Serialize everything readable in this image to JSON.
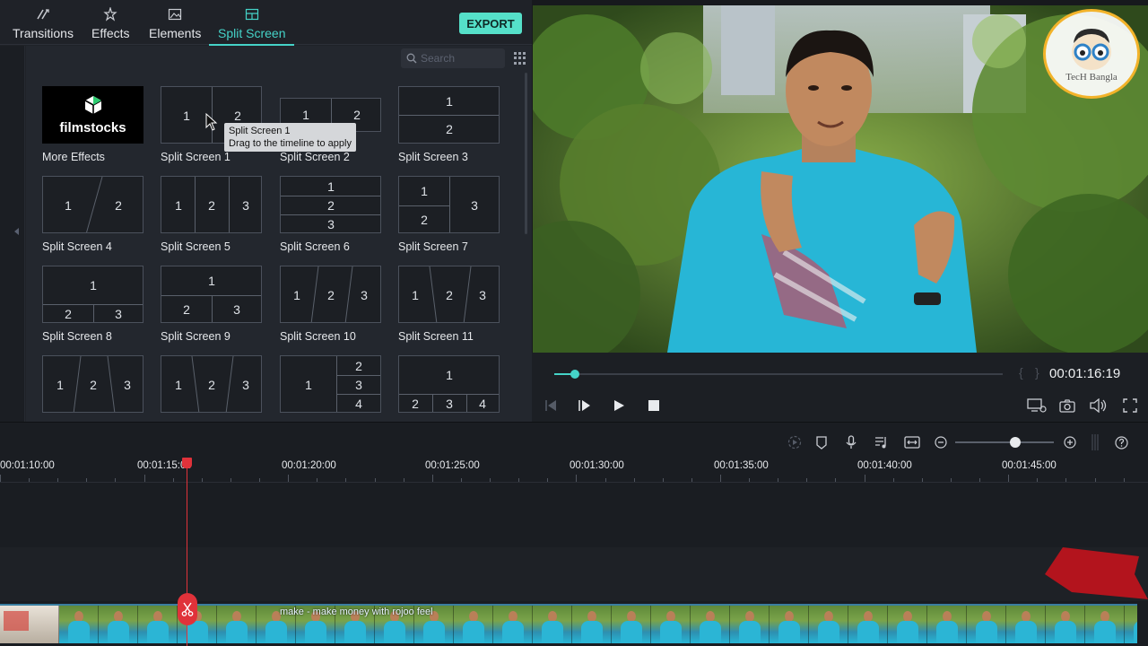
{
  "tabs": [
    {
      "label": "Transitions",
      "icon": "transitions-icon"
    },
    {
      "label": "Effects",
      "icon": "effects-icon"
    },
    {
      "label": "Elements",
      "icon": "elements-icon"
    },
    {
      "label": "Split Screen",
      "icon": "split-screen-icon",
      "active": true
    }
  ],
  "export_label": "EXPORT",
  "search": {
    "placeholder": "Search",
    "value": ""
  },
  "library": {
    "more_effects": {
      "brand": "filmstocks",
      "label": "More Effects"
    },
    "items": [
      {
        "label": "Split Screen 1"
      },
      {
        "label": "Split Screen 2"
      },
      {
        "label": "Split Screen 3"
      },
      {
        "label": "Split Screen 4"
      },
      {
        "label": "Split Screen 5"
      },
      {
        "label": "Split Screen 6"
      },
      {
        "label": "Split Screen 7"
      },
      {
        "label": "Split Screen 8"
      },
      {
        "label": "Split Screen 9"
      },
      {
        "label": "Split Screen 10"
      },
      {
        "label": "Split Screen 11"
      }
    ],
    "thumb_numbers": {
      "one": "1",
      "two": "2",
      "three": "3",
      "four": "4"
    },
    "tooltip": {
      "title": "Split Screen 1",
      "hint": "Drag to the timeline to apply"
    }
  },
  "preview": {
    "watermark": "TecH Bangla",
    "timecode": "00:01:16:19",
    "progress": 0.046
  },
  "timeline": {
    "ruler": [
      "00:01:10:00",
      "00:01:15:00",
      "00:01:20:00",
      "00:01:25:00",
      "00:01:30:00",
      "00:01:35:00",
      "00:01:40:00",
      "00:01:45:00"
    ],
    "zoom_level": 0.61,
    "clip_title": "make - make money with rojoo feel"
  },
  "colors": {
    "accent": "#45d3c8",
    "export": "#55e0c9",
    "playhead": "#e0323a"
  }
}
